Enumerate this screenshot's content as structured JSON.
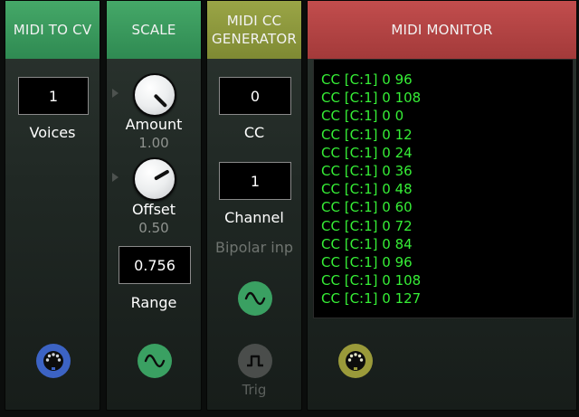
{
  "modules": {
    "midi_to_cv": {
      "title": "MIDI TO CV",
      "voices_value": "1",
      "voices_label": "Voices",
      "header_color": "#3b9a5d",
      "port_icon": "midi-din-icon",
      "port_color": "#3c63c4"
    },
    "scale": {
      "title": "SCALE",
      "amount_label": "Amount",
      "amount_value": "1.00",
      "offset_label": "Offset",
      "offset_value": "0.50",
      "range_value": "0.756",
      "range_label": "Range",
      "header_color": "#3b9a5d",
      "port_icon": "sine-wave-icon",
      "port_color": "#3aa062"
    },
    "midi_cc_generator": {
      "title_line1": "MIDI CC",
      "title_line2": "GENERATOR",
      "cc_value": "0",
      "cc_label": "CC",
      "channel_value": "1",
      "channel_label": "Channel",
      "bipolar_label": "Bipolar inp",
      "trig_label": "Trig",
      "header_color": "#8f9a3c",
      "sine_port_color": "#3aa062",
      "trig_port_color": "#4a4d4b",
      "port_icons": [
        "sine-wave-icon",
        "square-pulse-icon"
      ]
    },
    "midi_monitor": {
      "title": "MIDI MONITOR",
      "header_color": "#b84444",
      "port_icon": "midi-din-icon",
      "port_color": "#9a9a3a",
      "lines": [
        "CC [C:1] 0 96",
        "CC [C:1] 0 108",
        "CC [C:1] 0 0",
        "CC [C:1] 0 12",
        "CC [C:1] 0 24",
        "CC [C:1] 0 36",
        "CC [C:1] 0 48",
        "CC [C:1] 0 60",
        "CC [C:1] 0 72",
        "CC [C:1] 0 84",
        "CC [C:1] 0 96",
        "CC [C:1] 0 108",
        "CC [C:1] 0 127"
      ]
    }
  }
}
